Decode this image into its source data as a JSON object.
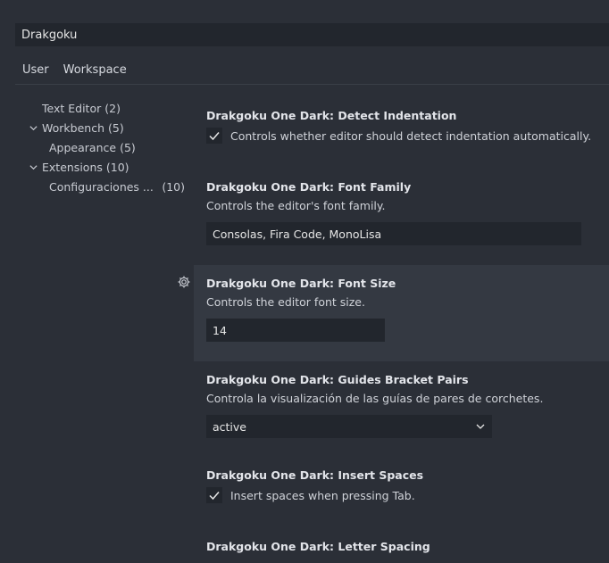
{
  "search": {
    "value": "Drakgoku"
  },
  "tabs": [
    {
      "label": "User"
    },
    {
      "label": "Workspace"
    }
  ],
  "toc": {
    "items": [
      {
        "label": "Text Editor",
        "count": "(2)"
      },
      {
        "label": "Workbench",
        "count": "(5)"
      },
      {
        "label": "Appearance",
        "count": "(5)"
      },
      {
        "label": "Extensions",
        "count": "(10)"
      },
      {
        "label": "Configuraciones ...",
        "count": "(10)"
      }
    ]
  },
  "settings": [
    {
      "title": "Drakgoku One Dark: Detect Indentation",
      "checkbox_label": "Controls whether editor should detect indentation automatically.",
      "checked": true
    },
    {
      "title": "Drakgoku One Dark: Font Family",
      "description": "Controls the editor's font family.",
      "value": "Consolas, Fira Code, MonoLisa"
    },
    {
      "title": "Drakgoku One Dark: Font Size",
      "description": "Controls the editor font size.",
      "value": "14"
    },
    {
      "title": "Drakgoku One Dark: Guides Bracket Pairs",
      "description": "Controla la visualización de las guías de pares de corchetes.",
      "value": "active"
    },
    {
      "title": "Drakgoku One Dark: Insert Spaces",
      "checkbox_label": "Insert spaces when pressing Tab.",
      "checked": true
    },
    {
      "title": "Drakgoku One Dark: Letter Spacing"
    }
  ],
  "icons": {
    "gear": "gear-icon",
    "chevron": "chevron-down-icon",
    "check": "check-icon"
  },
  "colors": {
    "background": "#2b2f37",
    "input_bg": "#22262d",
    "focused_row": "#343942"
  }
}
